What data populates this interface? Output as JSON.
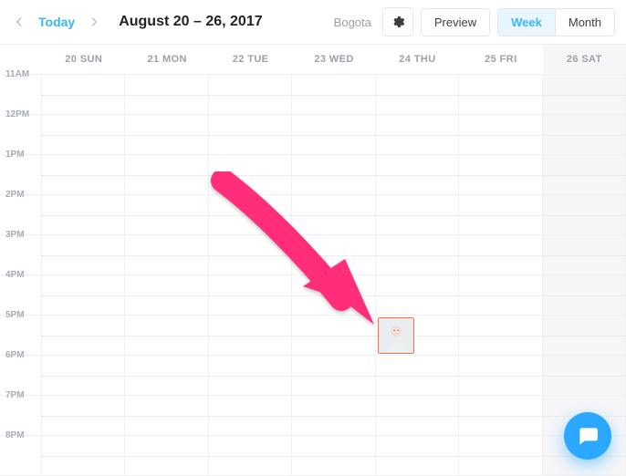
{
  "header": {
    "today_label": "Today",
    "date_range": "August 20 – 26, 2017",
    "timezone": "Bogota",
    "preview_label": "Preview",
    "view_buttons": {
      "week": "Week",
      "month": "Month"
    },
    "active_view": "week"
  },
  "days": [
    {
      "label": "20 SUN"
    },
    {
      "label": "21 MON"
    },
    {
      "label": "22 TUE"
    },
    {
      "label": "23 WED"
    },
    {
      "label": "24 THU"
    },
    {
      "label": "25 FRI"
    },
    {
      "label": "26 SAT"
    }
  ],
  "hours": [
    "11AM",
    "12PM",
    "1PM",
    "2PM",
    "3PM",
    "4PM",
    "5PM",
    "6PM",
    "7PM",
    "8PM"
  ],
  "event": {
    "day_index": 4,
    "start_hour_label": "5PM",
    "avatar_alt": "person-avatar"
  },
  "icons": {
    "settings": "gear-icon",
    "prev": "chevron-left-icon",
    "next": "chevron-right-icon",
    "chat": "chat-bubble-icon"
  },
  "colors": {
    "accent": "#35b6ff",
    "event_border": "#ff6b4a",
    "arrow": "#ff2d7a",
    "chat_fab": "#2aa7ff"
  }
}
